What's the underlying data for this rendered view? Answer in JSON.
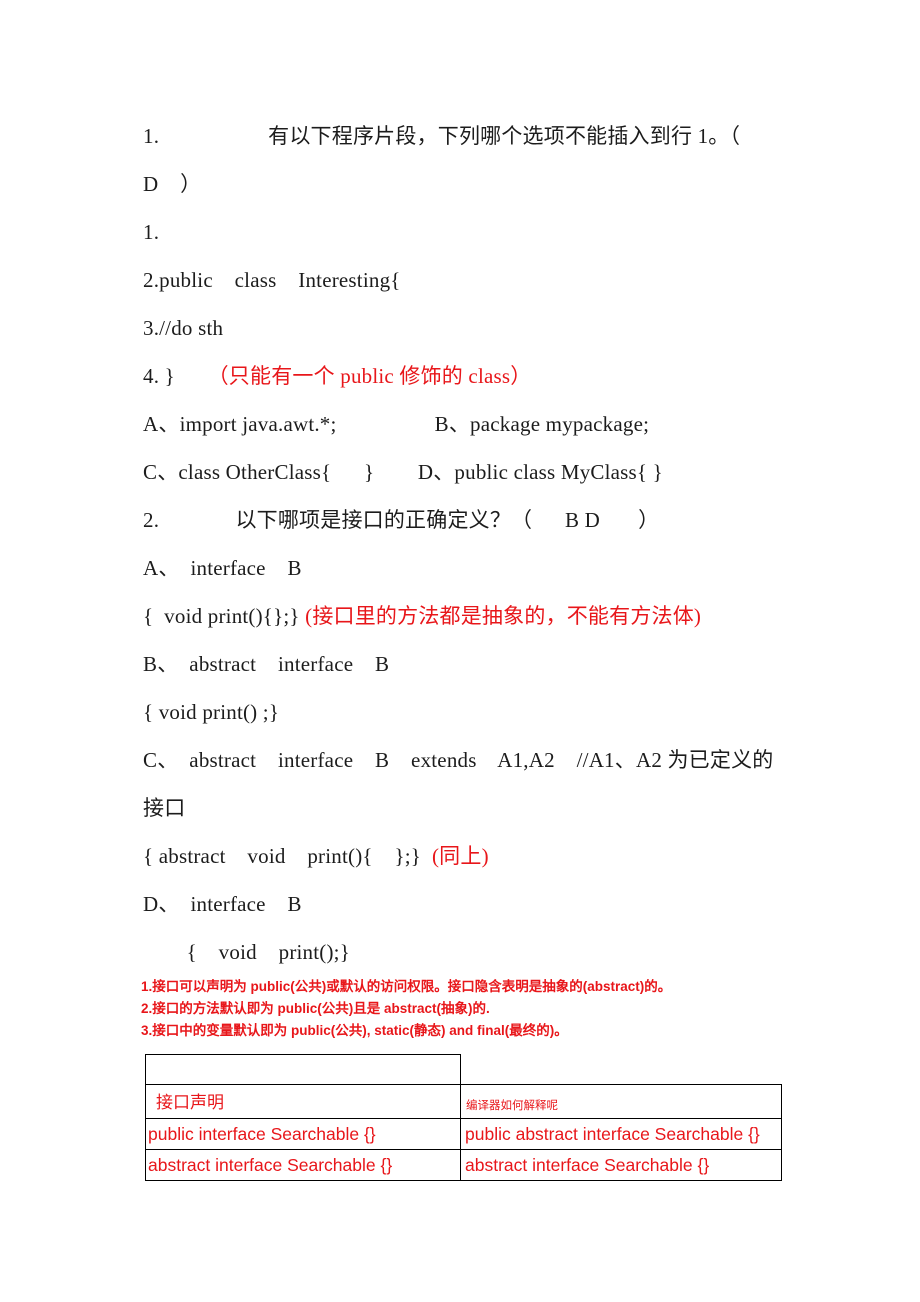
{
  "document": {
    "type": "java-quiz-worksheet",
    "colors": {
      "ink": "#1c1c1c",
      "annotation_red": "#e8161a",
      "table_border": "#000000",
      "page_background": "#ffffff"
    }
  },
  "questions": [
    {
      "number": "1.",
      "prompt_line1": "1.                    有以下程序片段，下列哪个选项不能插入到行 1。（",
      "prompt_line2": "D    ）",
      "answer": "D",
      "code_lines": [
        "1.",
        "2.public    class    Interesting{",
        "3.//do sth"
      ],
      "code_last_line": "4. }",
      "code_last_annotation": "（只能有一个 public 修饰的 class）",
      "options_line1": "A、import java.awt.*;                  B、package mypackage;",
      "options_line2": "C、class OtherClass{      }        D、public class MyClass{ }"
    },
    {
      "number": "2.",
      "prompt": "2.              以下哪项是接口的正确定义？（      B D       ）",
      "answer": "B D",
      "options": [
        {
          "label": "A、  interface    B",
          "body": "{  void print(){};}",
          "annotation": " (接口里的方法都是抽象的，不能有方法体)"
        },
        {
          "label": "B、  abstract    interface    B",
          "body": "{ void print() ;}",
          "annotation": ""
        },
        {
          "label": "C、  abstract    interface    B    extends    A1,A2    //A1、A2 为已定义的",
          "label_cont": "接口",
          "body": "{ abstract    void    print(){    };}",
          "annotation": "  (同上)"
        },
        {
          "label": "D、  interface    B",
          "body": "        {    void    print();}",
          "annotation": ""
        }
      ]
    }
  ],
  "notes": [
    "1.接口可以声明为 public(公共)或默认的访问权限。接口隐含表明是抽象的(abstract)的。",
    "2.接口的方法默认即为 public(公共)且是 abstract(抽象)的.",
    "3.接口中的变量默认即为 public(公共), static(静态) and final(最终的)。"
  ],
  "table": {
    "headers": {
      "left": "接口声明",
      "right": "编译器如何解释呢"
    },
    "rows": [
      {
        "left": "public interface Searchable {}",
        "right": "public abstract interface Searchable {}"
      },
      {
        "left": "abstract interface Searchable {}",
        "right": "abstract interface Searchable {}"
      }
    ]
  }
}
